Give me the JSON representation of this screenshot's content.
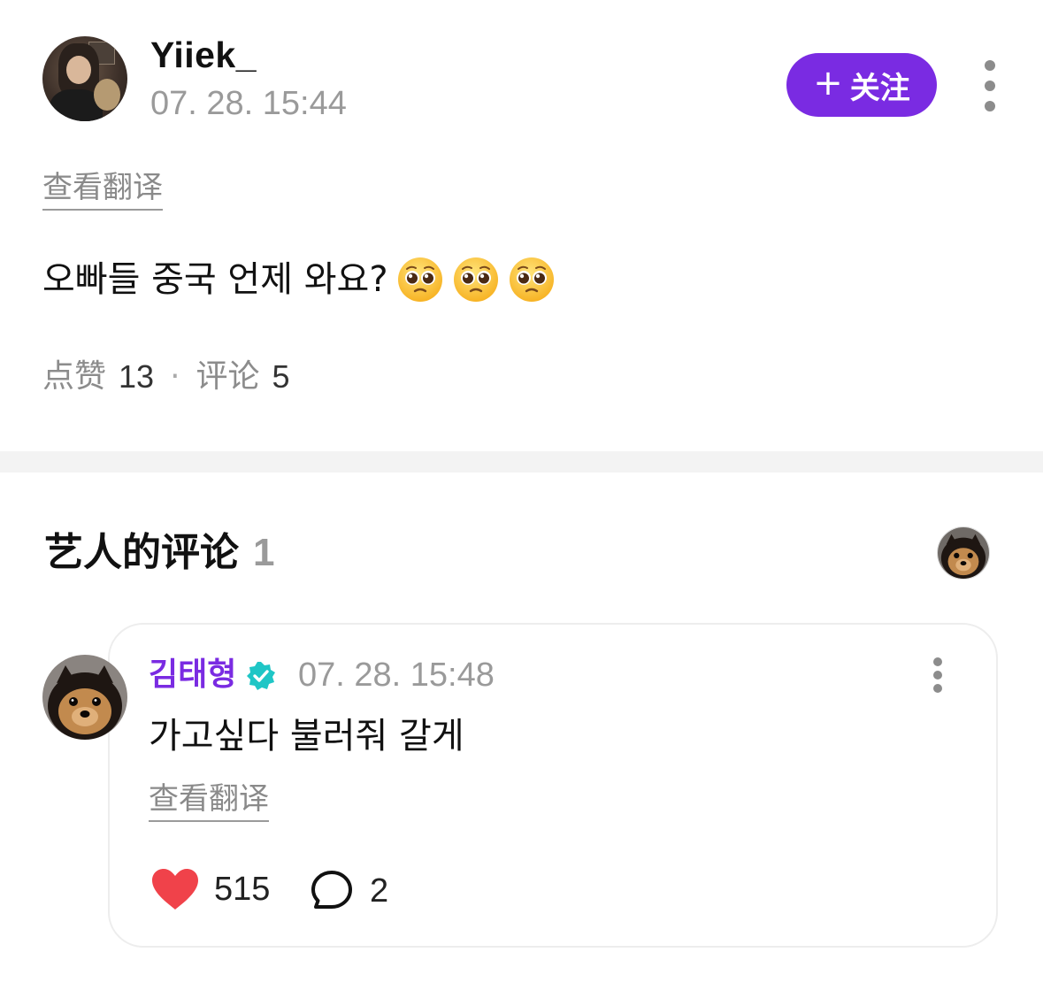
{
  "post": {
    "author": "Yiiek_",
    "time": "07. 28. 15:44",
    "follow_label": "关注",
    "translate_label": "查看翻译",
    "body": "오빠들 중국 언제 와요?",
    "emoji_name": "pleading-face",
    "emoji_count": 3,
    "likes_label": "点赞",
    "likes_count": "13",
    "separator": "·",
    "comments_label": "评论",
    "comments_count": "5"
  },
  "artist_section": {
    "title": "艺人的评论",
    "count": "1"
  },
  "comment": {
    "author": "김태형",
    "verified": true,
    "time": "07. 28. 15:48",
    "body": "가고싶다 불러줘 갈게",
    "translate_label": "查看翻译",
    "likes": "515",
    "replies": "2"
  },
  "colors": {
    "accent": "#7a2be2",
    "heart": "#f0424a",
    "verified": "#1fc6c6",
    "muted": "#9a9a9a",
    "divider": "#f3f3f3"
  }
}
